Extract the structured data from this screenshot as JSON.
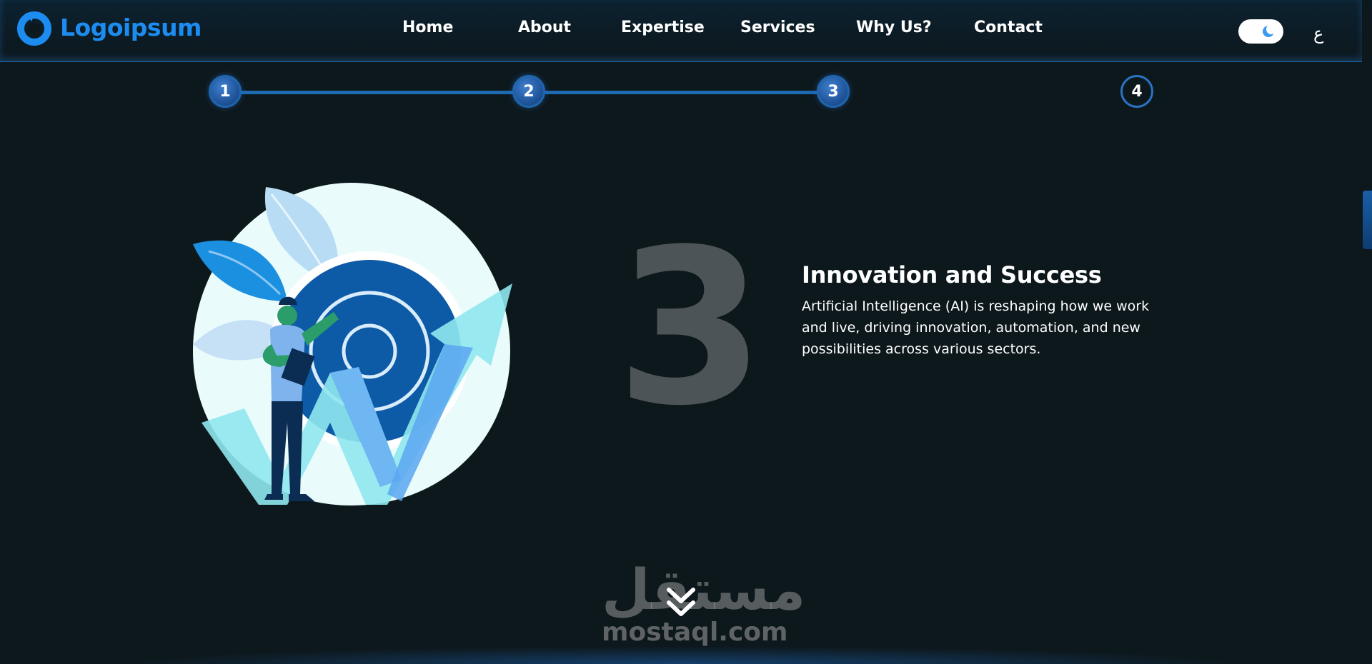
{
  "header": {
    "logo_text": "Logoipsum",
    "nav": [
      {
        "label": "Home"
      },
      {
        "label": "About"
      },
      {
        "label": "Expertise"
      },
      {
        "label": "Services"
      },
      {
        "label": "Why Us?"
      },
      {
        "label": "Contact"
      }
    ],
    "theme_toggle_icon": "moon-icon",
    "language_label": "ع"
  },
  "stepper": {
    "steps": [
      {
        "label": "1",
        "state": "done"
      },
      {
        "label": "2",
        "state": "done"
      },
      {
        "label": "3",
        "state": "active"
      },
      {
        "label": "4",
        "state": "todo"
      }
    ]
  },
  "section": {
    "number": "3",
    "title": "Innovation and Success",
    "description": "Artificial Intelligence (AI) is reshaping how we work and live, driving innovation, automation, and new possibilities across various sectors."
  },
  "watermark": {
    "arabic": "مستقل",
    "domain": "mostaql.com"
  },
  "icons": {
    "scroll": "double-chevron-down-icon",
    "logo": "logo-icon",
    "illustration": "target-growth-illustration"
  },
  "colors": {
    "background": "#0d181d",
    "accent": "#1d8cf0",
    "step_fill": "#1c4f93",
    "number": "#4d5457"
  }
}
